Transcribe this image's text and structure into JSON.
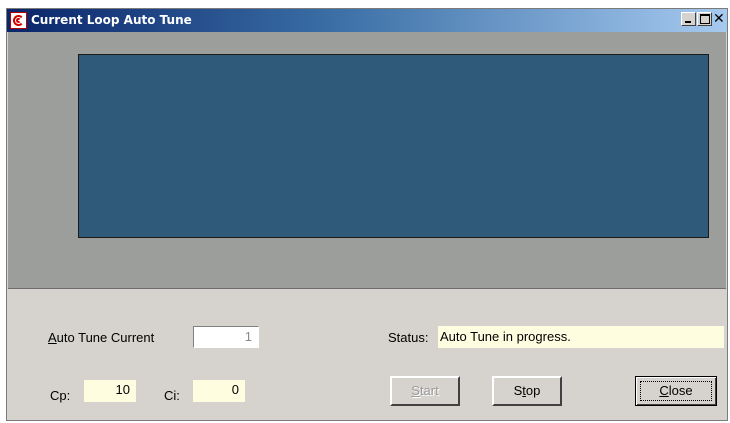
{
  "window": {
    "title": "Current Loop Auto Tune",
    "controls": {
      "minimize": "minimize-icon",
      "maximize": "maximize-icon",
      "close": "✕"
    }
  },
  "plot": {
    "background": "#2f5a7a"
  },
  "form": {
    "auto_tune_current": {
      "label_prefix": "A",
      "label_rest": "uto Tune Current",
      "value": "1"
    },
    "cp": {
      "label": "Cp:",
      "value": "10"
    },
    "ci": {
      "label": "Ci:",
      "value": "0"
    },
    "status": {
      "label": "Status:",
      "value": "Auto Tune in progress."
    }
  },
  "buttons": {
    "start": {
      "prefix": "S",
      "rest": "tart",
      "enabled": false
    },
    "stop": {
      "pre": "S",
      "underline": "t",
      "post": "op"
    },
    "close": {
      "prefix": "C",
      "rest": "lose"
    }
  }
}
